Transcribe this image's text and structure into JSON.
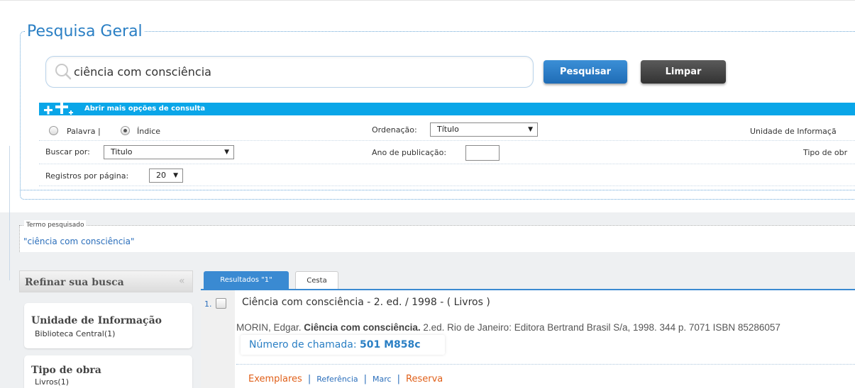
{
  "search": {
    "title": "Pesquisa Geral",
    "query": "ciência com consciência",
    "search_button": "Pesquisar",
    "clear_button": "Limpar",
    "more_options": "Abrir mais opções de consulta"
  },
  "options": {
    "radio_word": "Palavra |",
    "radio_index": "Índice",
    "selected_radio": "Índice",
    "ordering_label": "Ordenação:",
    "ordering_value": "Título",
    "info_unit_label": "Unidade de Informaçã",
    "search_by_label": "Buscar por:",
    "search_by_value": "Titulo",
    "year_label": "Ano de publicação:",
    "year_value": "",
    "work_type_label": "Tipo de obr",
    "per_page_label": "Registros por página:",
    "per_page_value": "20"
  },
  "term": {
    "legend": "Termo pesquisado",
    "value": "\"ciência com consciência\""
  },
  "refine": {
    "title": "Refinar sua busca",
    "collapse_glyph": "«",
    "facets": [
      {
        "title": "Unidade de Informação",
        "item": "Biblioteca Central(1)"
      },
      {
        "title": "Tipo de obra",
        "item": "Livros(1)"
      }
    ]
  },
  "tabs": {
    "results": "Resultados \"1\"",
    "cart": "Cesta"
  },
  "result": {
    "number": "1.",
    "title": "Ciência com consciência - 2. ed. / 1998 - ( Livros )",
    "ref_author": "MORIN, Edgar. ",
    "ref_title": "Ciência com consciência.",
    "ref_rest": " 2.ed. Rio de Janeiro: Editora Bertrand Brasil S/a, 1998. 344 p. 7071 ISBN 85286057",
    "call_number_label": "Número de chamada: ",
    "call_number_value": "501 M858c",
    "actions": {
      "exemplares": "Exemplares",
      "referencia": "Referência",
      "marc": "Marc",
      "reserva": "Reserva",
      "separator": "|"
    }
  }
}
